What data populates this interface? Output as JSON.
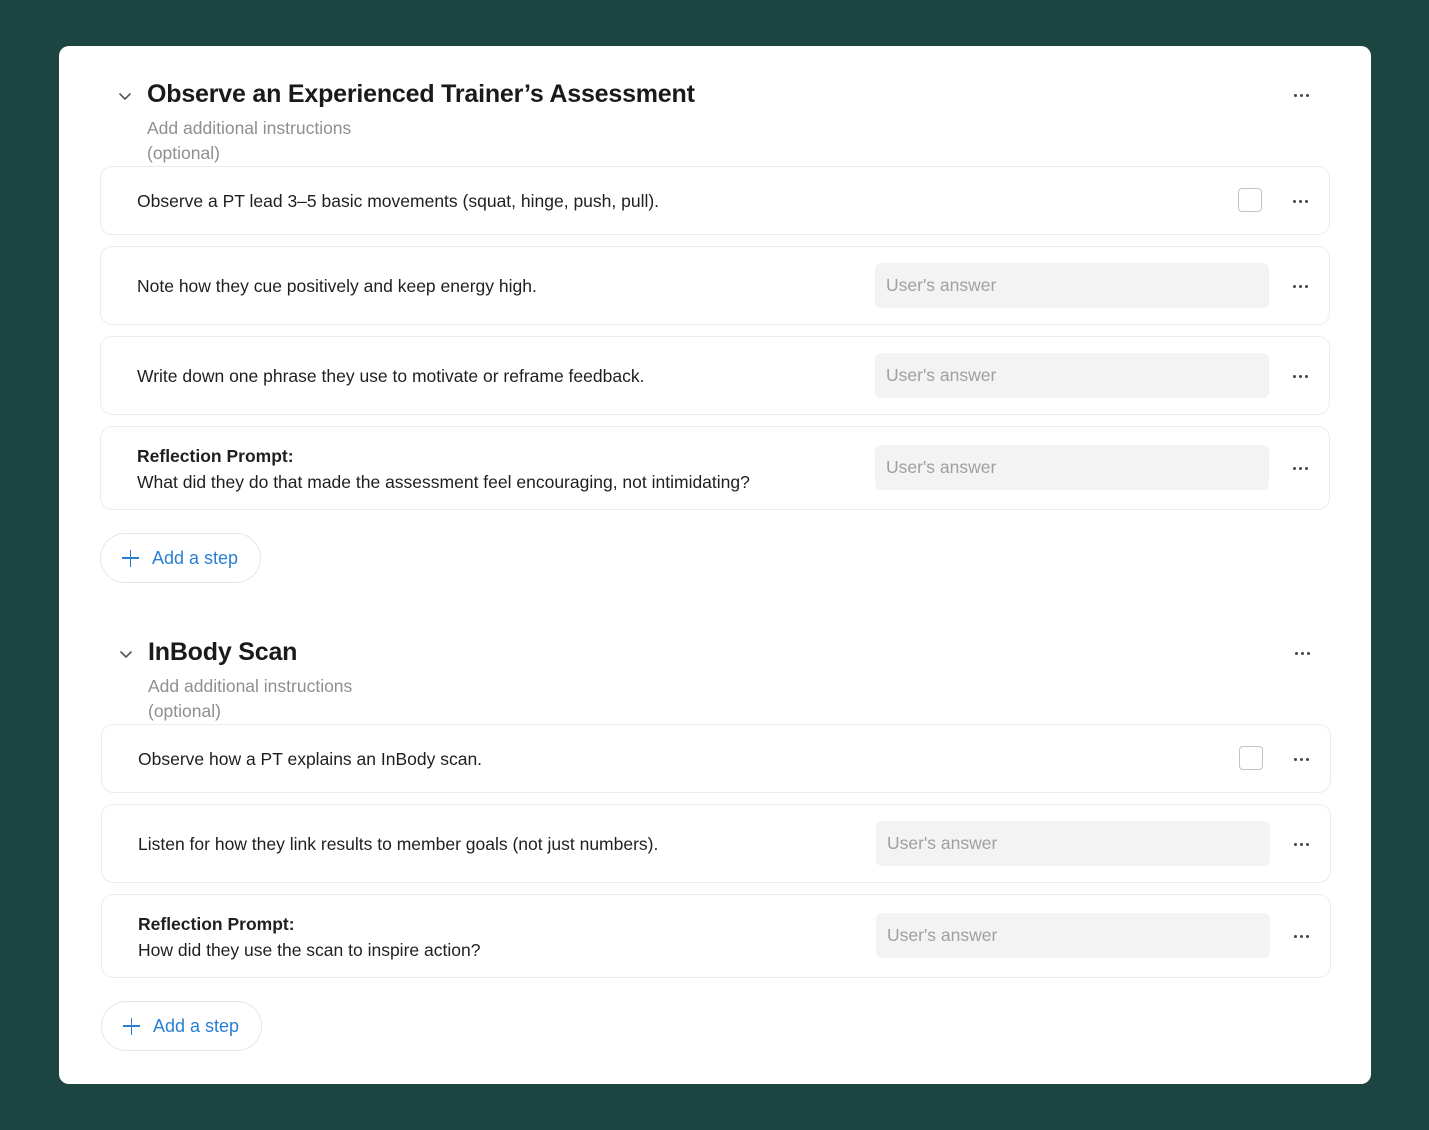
{
  "sections": [
    {
      "title": "Observe an Experienced Trainer’s Assessment",
      "instructions": "Add additional instructions (optional)",
      "add_step_label": "Add a step",
      "steps": [
        {
          "type": "checkbox",
          "text": "Observe a PT lead 3–5 basic movements (squat, hinge, push, pull).",
          "checked": false
        },
        {
          "type": "answer",
          "text": "Note how they cue positively and keep energy high.",
          "placeholder": "User's answer"
        },
        {
          "type": "answer",
          "text": "Write down one phrase they use to motivate or reframe feedback.",
          "placeholder": "User's answer"
        },
        {
          "type": "answer",
          "label": "Reflection Prompt:",
          "text": "What did they do that made the assessment feel encouraging, not intimidating?",
          "placeholder": "User's answer"
        }
      ]
    },
    {
      "title": "InBody Scan",
      "instructions": "Add additional instructions (optional)",
      "add_step_label": "Add a step",
      "steps": [
        {
          "type": "checkbox",
          "text": "Observe how a PT explains an InBody scan.",
          "checked": false
        },
        {
          "type": "answer",
          "text": "Listen for how they link results to member goals (not just numbers).",
          "placeholder": "User's answer"
        },
        {
          "type": "answer",
          "label": "Reflection Prompt:",
          "text": "How did they use the scan to inspire action?",
          "placeholder": "User's answer"
        }
      ]
    }
  ],
  "icons": {
    "collapse": "chevron-down-icon",
    "more": "more-horizontal-icon",
    "add": "plus-icon"
  },
  "colors": {
    "background": "#1c4440",
    "accent": "#2a7fd4",
    "card": "#ffffff"
  }
}
